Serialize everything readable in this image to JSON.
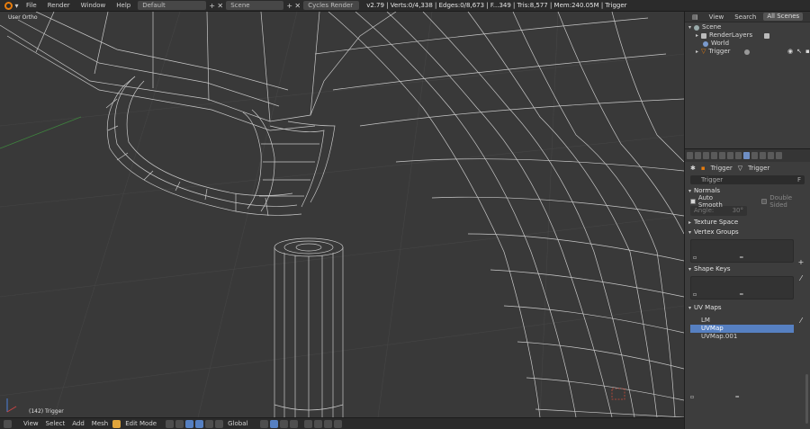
{
  "topbar": {
    "menus": [
      "File",
      "Render",
      "Window",
      "Help"
    ],
    "layout": "Default",
    "scene": "Scene",
    "engine": "Cycles Render",
    "stats": "v2.79 | Verts:0/4,338 | Edges:0/8,673 | F...349 | Tris:8,577 | Mem:240.05M | Trigger"
  },
  "viewport": {
    "view_label": "User Ortho",
    "object_label": "(142) Trigger"
  },
  "bottombar": {
    "items": [
      "View",
      "Select",
      "Add",
      "Mesh"
    ],
    "mode": "Edit Mode",
    "pivot": "Global"
  },
  "outliner": {
    "header": {
      "view": "View",
      "search": "Search",
      "scenes": "All Scenes"
    },
    "rows": [
      "Scene",
      "RenderLayers",
      "World",
      "Trigger"
    ]
  },
  "properties": {
    "breadcrumb": [
      "Trigger",
      "Trigger"
    ],
    "mesh_name": "Trigger",
    "normals": {
      "title": "Normals",
      "auto_smooth": "Auto Smooth",
      "double_sided": "Double Sided",
      "angle_label": "Angle:",
      "angle_value": "30°"
    },
    "panels": {
      "texture_space": "Texture Space",
      "vertex_groups": "Vertex Groups",
      "shape_keys": "Shape Keys",
      "uv_maps": "UV Maps"
    },
    "uv_maps": [
      "LM",
      "UVMap",
      "UVMap.001"
    ]
  },
  "colors": {
    "accent": "#5680c2",
    "viewport_bg": "#393939",
    "wire": "#d8d8d8",
    "orange": "#e87d0d"
  }
}
